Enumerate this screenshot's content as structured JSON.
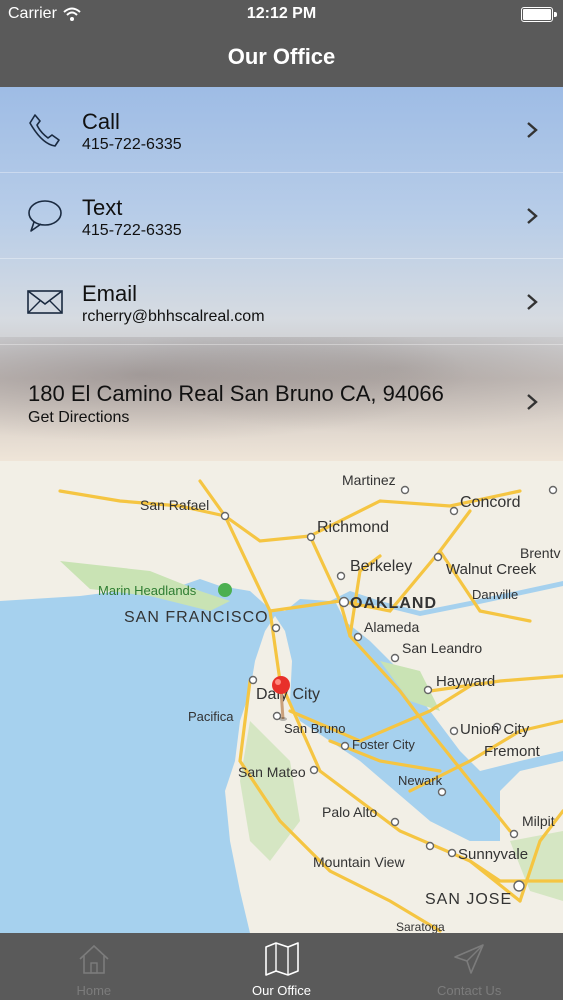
{
  "status_bar": {
    "carrier": "Carrier",
    "time": "12:12 PM"
  },
  "nav": {
    "title": "Our Office"
  },
  "contact": {
    "call": {
      "label": "Call",
      "value": "415-722-6335",
      "icon": "phone-icon"
    },
    "text": {
      "label": "Text",
      "value": "415-722-6335",
      "icon": "speech-bubble-icon"
    },
    "email": {
      "label": "Email",
      "value": "rcherry@bhhscalreal.com",
      "icon": "envelope-icon"
    },
    "address": {
      "label": "180 El Camino Real San Bruno CA, 94066",
      "sub": "Get Directions"
    }
  },
  "map": {
    "places": {
      "martinez": "Martinez",
      "concord": "Concord",
      "san_rafael": "San Rafael",
      "richmond": "Richmond",
      "brentwood": "Brentv",
      "berkeley": "Berkeley",
      "walnut_creek": "Walnut Creek",
      "marin_headlands": "Marin Headlands",
      "danville": "Danville",
      "oakland": "OAKLAND",
      "san_francisco": "SAN FRANCISCO",
      "alameda": "Alameda",
      "san_leandro": "San Leandro",
      "hayward": "Hayward",
      "daly_city": "Daly City",
      "pacifica": "Pacifica",
      "san_bruno": "San Bruno",
      "union_city": "Union City",
      "fremont": "Fremont",
      "foster_city": "Foster City",
      "san_mateo": "San Mateo",
      "newark": "Newark",
      "palo_alto": "Palo Alto",
      "milpitas": "Milpit",
      "mountain_view": "Mountain View",
      "sunnyvale": "Sunnyvale",
      "san_jose": "SAN JOSE",
      "saratoga": "Saratoga"
    },
    "colors": {
      "water": "#a6d1ee",
      "land": "#f2efe6",
      "park": "#c9e3b4",
      "highway": "#f5c542",
      "pin": "#e8302a"
    }
  },
  "tabs": [
    {
      "label": "Home",
      "icon": "home-icon",
      "active": false
    },
    {
      "label": "Our Office",
      "icon": "map-icon",
      "active": true
    },
    {
      "label": "Contact Us",
      "icon": "paper-plane-icon",
      "active": false
    }
  ]
}
